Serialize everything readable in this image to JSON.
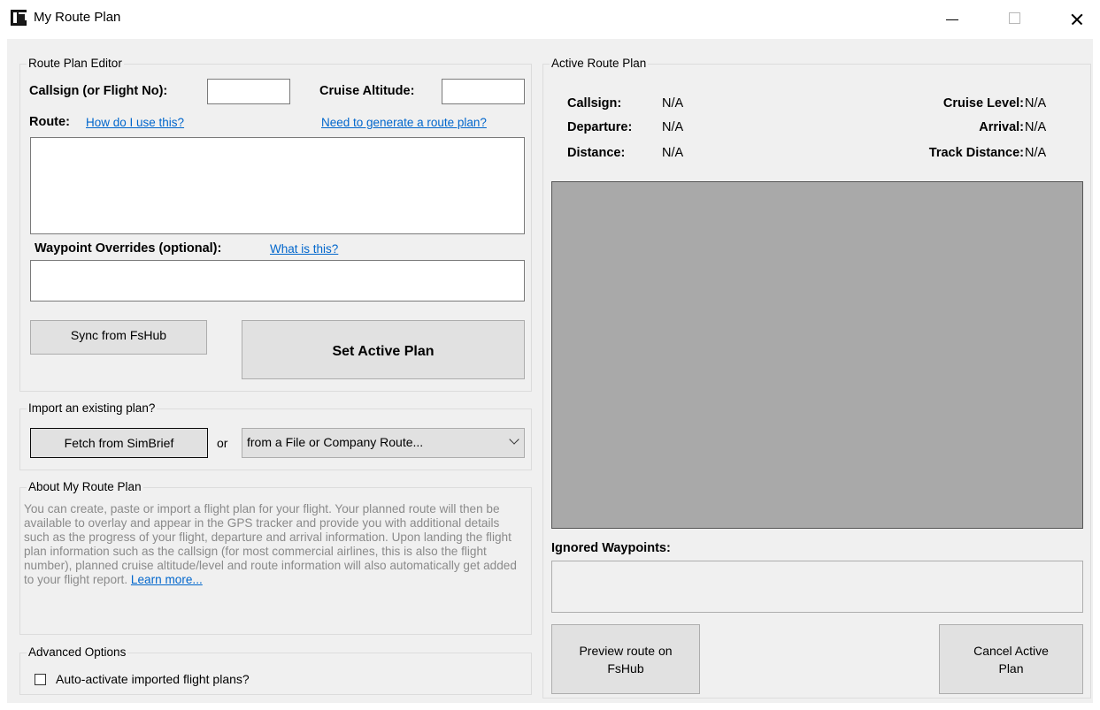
{
  "window": {
    "title": "My Route Plan",
    "app_icon": "app-logo-icon",
    "minimize_icon": "minimize-icon",
    "maximize_icon": "maximize-icon",
    "close_icon": "close-icon"
  },
  "editor": {
    "group_title": "Route Plan Editor",
    "callsign_label": "Callsign (or Flight No):",
    "callsign_value": "",
    "cruise_altitude_label": "Cruise Altitude:",
    "cruise_altitude_value": "",
    "route_label": "Route:",
    "route_help_link": "How do I use this?",
    "generate_link": "Need to generate a route plan?",
    "route_value": "",
    "waypoint_overrides_label": "Waypoint Overrides (optional):",
    "waypoint_help_link": "What is this?",
    "waypoint_overrides_value": "",
    "sync_button": "Sync from FsHub",
    "set_active_button": "Set Active Plan"
  },
  "import": {
    "group_title": "Import an existing plan?",
    "simbrief_button": "Fetch from SimBrief",
    "or_label": "or",
    "source_select": "from a File or Company Route..."
  },
  "about": {
    "group_title": "About My Route Plan",
    "text": "You can create, paste or import a flight plan for your flight. Your planned route will then be available to overlay and appear in the GPS tracker and provide you with additional details such as the progress of your flight, departure and arrival information. Upon landing the flight plan information such as the callsign (for most commercial airlines, this is also the flight number), planned cruise altitude/level and route information will also automatically get added to your flight report.",
    "learn_more_link": "Learn more..."
  },
  "advanced": {
    "group_title": "Advanced Options",
    "auto_activate_label": "Auto-activate imported flight plans?",
    "auto_activate_checked": false
  },
  "active": {
    "group_title": "Active Route Plan",
    "callsign_label": "Callsign:",
    "callsign_value": "N/A",
    "departure_label": "Departure:",
    "departure_value": "N/A",
    "distance_label": "Distance:",
    "distance_value": "N/A",
    "cruise_level_label": "Cruise Level:",
    "cruise_level_value": "N/A",
    "arrival_label": "Arrival:",
    "arrival_value": "N/A",
    "track_distance_label": "Track Distance:",
    "track_distance_value": "N/A",
    "map_color": "#a9a9a9",
    "ignored_waypoints_label": "Ignored Waypoints:",
    "ignored_waypoints_value": "",
    "preview_button": "Preview route on FsHub",
    "cancel_button": "Cancel Active Plan"
  }
}
